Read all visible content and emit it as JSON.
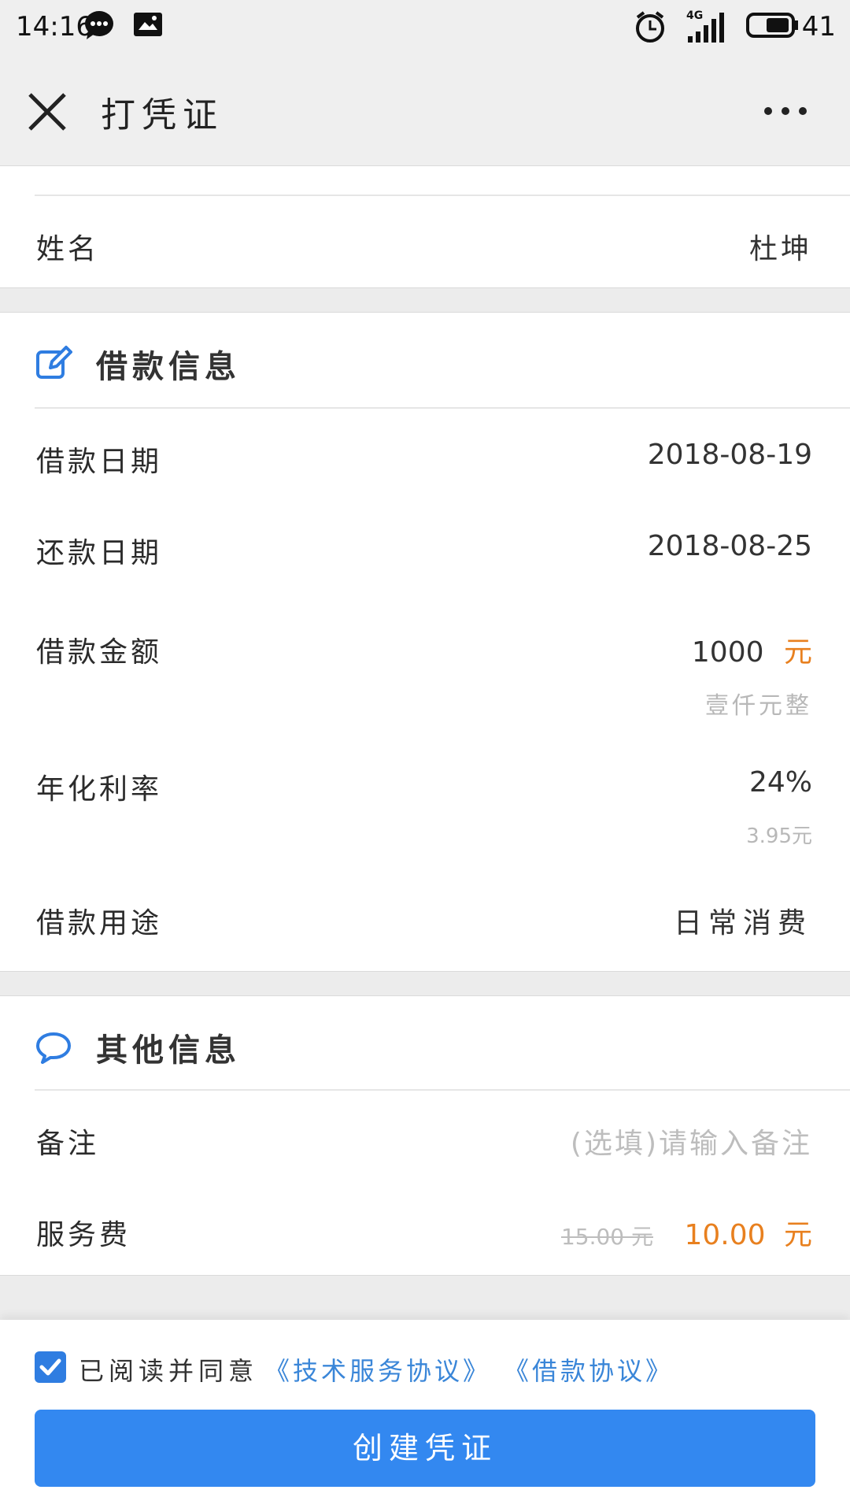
{
  "status_bar": {
    "time": "14:16",
    "network": "4G",
    "battery": "41"
  },
  "header": {
    "title": "打凭证"
  },
  "borrower": {
    "name_label": "姓名",
    "name_value": "杜坤"
  },
  "loan_section": {
    "title": "借款信息",
    "loan_date_label": "借款日期",
    "loan_date_value": "2018-08-19",
    "repay_date_label": "还款日期",
    "repay_date_value": "2018-08-25",
    "amount_label": "借款金额",
    "amount_value": "1000",
    "amount_unit": "元",
    "amount_in_words": "壹仟元整",
    "rate_label": "年化利率",
    "rate_value": "24%",
    "interest": "3.95元",
    "purpose_label": "借款用途",
    "purpose_value": "日常消费"
  },
  "other_section": {
    "title": "其他信息",
    "remark_label": "备注",
    "remark_placeholder": "(选填)请输入备注",
    "fee_label": "服务费",
    "fee_original": "15.00 元",
    "fee_current": "10.00",
    "fee_unit": "元"
  },
  "footer": {
    "agree_text": "已阅读并同意",
    "link_tech": "《技术服务协议》",
    "link_loan": "《借款协议》",
    "agree_checked": true,
    "create_button": "创建凭证"
  },
  "colors": {
    "accent": "#3388f0",
    "orange": "#e8801f",
    "link": "#3a86d8"
  }
}
